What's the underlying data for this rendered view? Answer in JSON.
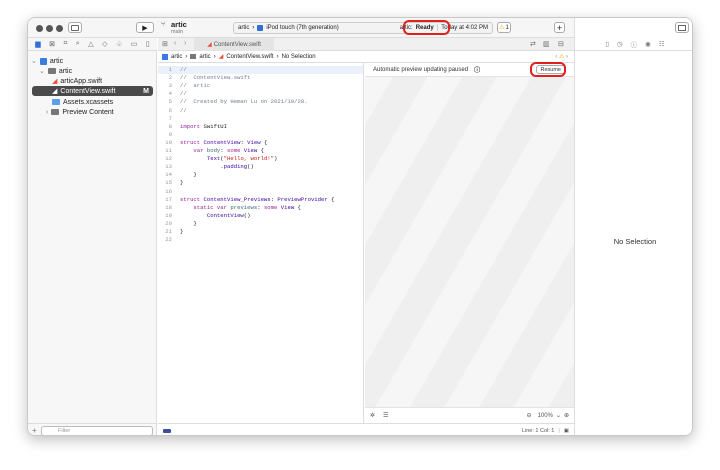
{
  "toolbar": {
    "project": "artic",
    "branch": "main",
    "scheme": "artic",
    "device": "iPod touch (7th generation)",
    "status_prefix": "artic:",
    "status_state": "Ready",
    "status_time": "Today at 4:02 PM",
    "warnings": "1"
  },
  "editor_tab": "ContentView.swift",
  "jump_bar": [
    "artic",
    "artic",
    "ContentView.swift",
    "No Selection"
  ],
  "navigator": {
    "items": [
      {
        "label": "artic",
        "badge": ""
      },
      {
        "label": "artic",
        "badge": ""
      },
      {
        "label": "articApp.swift",
        "badge": ""
      },
      {
        "label": "ContentView.swift",
        "badge": "M"
      },
      {
        "label": "Assets.xcassets",
        "badge": ""
      },
      {
        "label": "Preview Content",
        "badge": ""
      }
    ],
    "filter_placeholder": "Filter"
  },
  "code": [
    [
      [
        "//",
        "c"
      ]
    ],
    [
      [
        "//  ContentView.swift",
        "c"
      ]
    ],
    [
      [
        "//  artic",
        "c"
      ]
    ],
    [
      [
        "//",
        "c"
      ]
    ],
    [
      [
        "//  Created by Heman Lu on 2021/10/28.",
        "c"
      ]
    ],
    [
      [
        "//",
        "c"
      ]
    ],
    [],
    [
      [
        "import",
        "k"
      ],
      [
        " SwiftUI",
        "p"
      ]
    ],
    [],
    [
      [
        "struct",
        "k"
      ],
      [
        " ContentView",
        "t"
      ],
      [
        ": ",
        "p"
      ],
      [
        "View",
        "t"
      ],
      [
        " {",
        "p"
      ]
    ],
    [
      [
        "    var",
        "k"
      ],
      [
        " body",
        "f"
      ],
      [
        ": ",
        "p"
      ],
      [
        "some",
        "k"
      ],
      [
        " View",
        "t"
      ],
      [
        " {",
        "p"
      ]
    ],
    [
      [
        "        Text",
        "t"
      ],
      [
        "(",
        "p"
      ],
      [
        "\"Hello, world!\"",
        "s"
      ],
      [
        ")",
        "p"
      ]
    ],
    [
      [
        "            .padding",
        "t"
      ],
      [
        "()",
        "p"
      ]
    ],
    [
      [
        "    }",
        "p"
      ]
    ],
    [
      [
        "}",
        "p"
      ]
    ],
    [],
    [
      [
        "struct",
        "k"
      ],
      [
        " ContentView_Previews",
        "t"
      ],
      [
        ": ",
        "p"
      ],
      [
        "PreviewProvider",
        "t"
      ],
      [
        " {",
        "p"
      ]
    ],
    [
      [
        "    static",
        "k"
      ],
      [
        " var",
        "k"
      ],
      [
        " previews",
        "f"
      ],
      [
        ": ",
        "p"
      ],
      [
        "some",
        "k"
      ],
      [
        " View",
        "t"
      ],
      [
        " {",
        "p"
      ]
    ],
    [
      [
        "        ContentView",
        "t"
      ],
      [
        "()",
        "p"
      ]
    ],
    [
      [
        "    }",
        "p"
      ]
    ],
    [
      [
        "}",
        "p"
      ]
    ],
    []
  ],
  "preview": {
    "message": "Automatic preview updating paused",
    "resume": "Resume",
    "zoom": "100%"
  },
  "status_bar": {
    "position": "Line: 1  Col: 1"
  },
  "inspector": {
    "empty": "No Selection"
  }
}
